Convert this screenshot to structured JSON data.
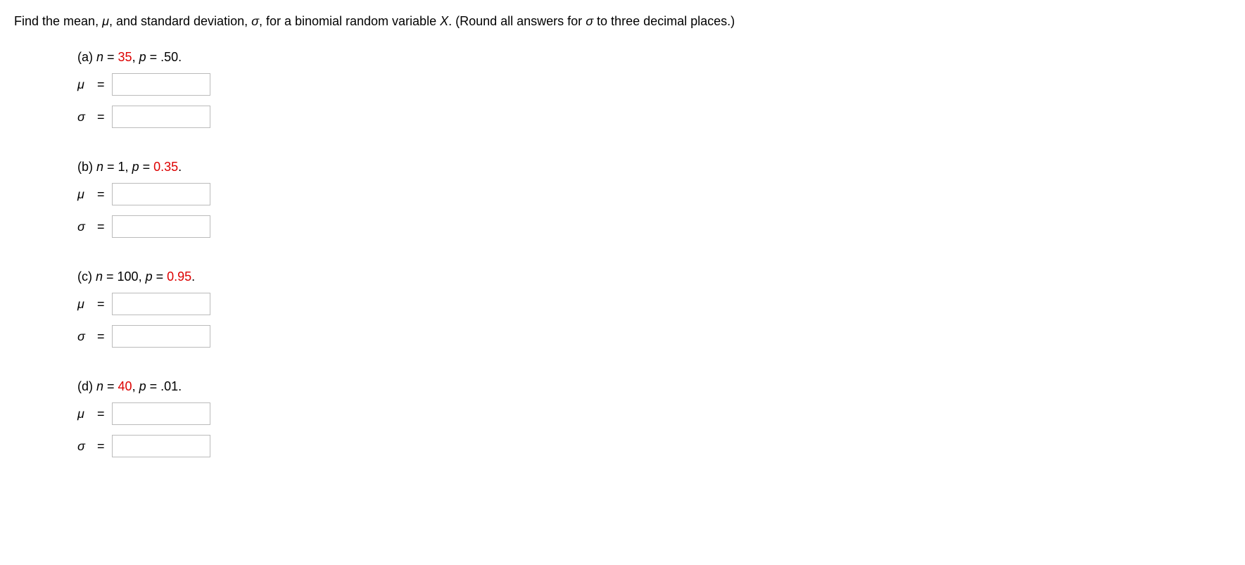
{
  "prompt": {
    "pre": "Find the mean, ",
    "mu": "μ",
    "mid1": ", and standard deviation, ",
    "sigma": "σ",
    "mid2": ", for a binomial random variable ",
    "X": "X",
    "mid3": ". (Round all answers for ",
    "sigma2": "σ",
    "post": " to three decimal places.)"
  },
  "labels": {
    "mu": "μ",
    "sigma": "σ",
    "eq": "="
  },
  "parts": {
    "a": {
      "label": "(a) ",
      "n_sym": "n",
      "eq1": " = ",
      "n_val": "35",
      "comma": ", ",
      "p_sym": "p",
      "eq2": " = ",
      "p_val": ".50",
      "period": "."
    },
    "b": {
      "label": "(b) ",
      "n_sym": "n",
      "eq1": " = ",
      "n_val": "1",
      "comma": ", ",
      "p_sym": "p",
      "eq2": " = ",
      "p_val": "0.35",
      "period": "."
    },
    "c": {
      "label": "(c) ",
      "n_sym": "n",
      "eq1": " = ",
      "n_val": "100",
      "comma": ", ",
      "p_sym": "p",
      "eq2": " = ",
      "p_val": "0.95",
      "period": "."
    },
    "d": {
      "label": "(d) ",
      "n_sym": "n",
      "eq1": " = ",
      "n_val": "40",
      "comma": ", ",
      "p_sym": "p",
      "eq2": " = ",
      "p_val": ".01",
      "period": "."
    }
  }
}
